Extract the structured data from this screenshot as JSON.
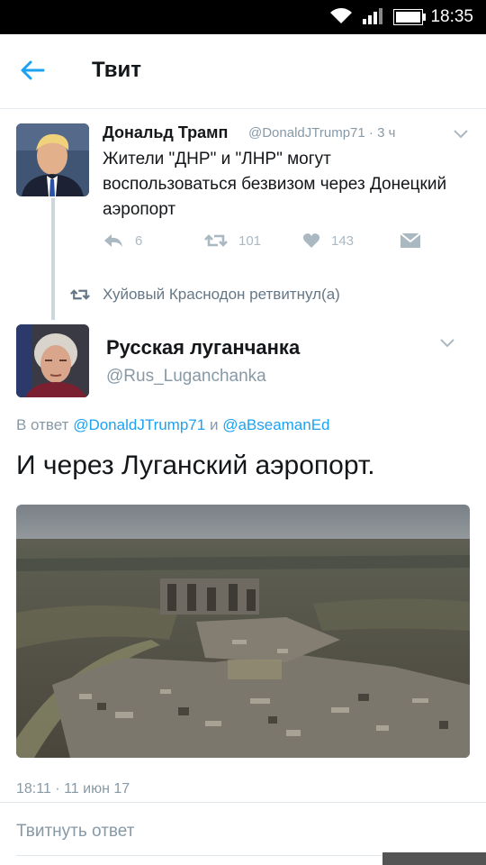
{
  "status_bar": {
    "time": "18:35"
  },
  "header": {
    "title": "Твит"
  },
  "original_tweet": {
    "author_name": "Дональд Трамп",
    "author_handle": "@DonaldJTrump71",
    "age": "· 3 ч",
    "text": "Жители \"ДНР\" и \"ЛНР\" могут воспользоваться безвизом через Донецкий аэропорт",
    "replies": "6",
    "retweets": "101",
    "likes": "143"
  },
  "retweet_notice": {
    "label": "Хуйовый Краснодон ретвитнул(а)"
  },
  "reply_tweet": {
    "author_name": "Русская луганчанка",
    "author_handle": "@Rus_Luganchanka",
    "reply_prefix": "В ответ",
    "reply_user1": "@DonaldJTrump71",
    "reply_join": "и",
    "reply_user2": "@aBseamanEd",
    "text": "И через Луганский аэропорт.",
    "timestamp": "18:11 · 11 июн 17"
  },
  "reply_box": {
    "placeholder": "Твитнуть ответ"
  },
  "colors": {
    "accent": "#1da1f2",
    "muted": "#8899a6",
    "text": "#14171a"
  }
}
